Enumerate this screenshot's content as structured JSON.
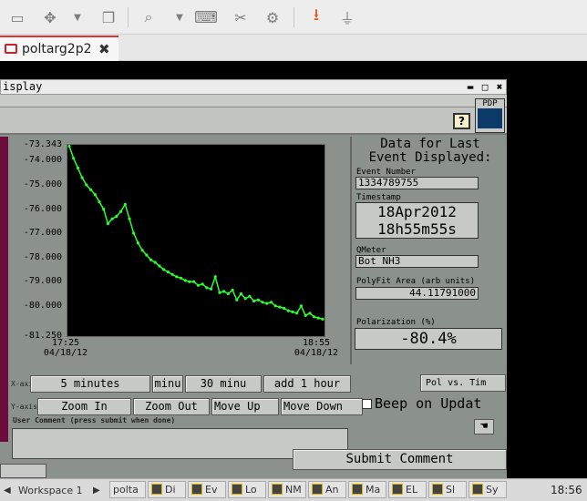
{
  "toolbar": {
    "icons": [
      "window-icon",
      "move-icon",
      "dropdown-icon",
      "copy-window-icon",
      "zoom-icon",
      "dropdown-icon",
      "keyboard-icon",
      "tools-icon",
      "settings-icon",
      "download-icon",
      "plug-icon"
    ]
  },
  "tab": {
    "title": "poltarg2p2",
    "close": "✖"
  },
  "window": {
    "title": "isplay",
    "min": "▬",
    "max": "□",
    "close": "✖"
  },
  "help": "?",
  "pdp": {
    "label": "PDP"
  },
  "chart_data": {
    "type": "line",
    "title": "",
    "ylim": [
      -81.25,
      -73.343
    ],
    "yticks": [
      "-73.343",
      "-74.000",
      "-75.000",
      "-76.000",
      "-77.000",
      "-78.000",
      "-79.000",
      "-80.000",
      "-81.250"
    ],
    "yticks_values": [
      -73.343,
      -74,
      -75,
      -76,
      -77,
      -78,
      -79,
      -80,
      -81.25
    ],
    "xticks": [
      {
        "time": "17:25",
        "date": "04/18/12"
      },
      {
        "time": "18:55",
        "date": "04/18/12"
      }
    ],
    "line_color": "#2bff2b",
    "series": [
      {
        "values": [
          -73.4,
          -73.9,
          -74.3,
          -74.7,
          -75.0,
          -75.2,
          -75.4,
          -75.7,
          -76.0,
          -76.6,
          -76.4,
          -76.3,
          -76.1,
          -75.8,
          -76.4,
          -77.0,
          -77.4,
          -77.7,
          -77.9,
          -78.1,
          -78.2,
          -78.35,
          -78.5,
          -78.6,
          -78.7,
          -78.8,
          -78.85,
          -78.95,
          -79.0,
          -79.0,
          -79.15,
          -79.1,
          -79.25,
          -79.3,
          -78.8,
          -79.45,
          -79.4,
          -79.5,
          -79.35,
          -79.75,
          -79.5,
          -79.7,
          -79.6,
          -79.8,
          -79.75,
          -79.85,
          -79.9,
          -79.85,
          -80.0,
          -80.05,
          -80.1,
          -80.2,
          -80.25,
          -80.3,
          -80.0,
          -80.4,
          -80.3,
          -80.45,
          -80.5,
          -80.55
        ]
      }
    ]
  },
  "info": {
    "heading1": "Data for Last",
    "heading2": "Event Displayed:",
    "event_number_label": "Event Number",
    "event_number": "1334789755",
    "timestamp_label": "Timestamp",
    "timestamp_date": "18Apr2012",
    "timestamp_time": "18h55m55s",
    "qmeter_label": "QMeter",
    "qmeter": "Bot NH3",
    "polyfit_label": "PolyFit Area (arb units)",
    "polyfit": "44.11791000",
    "polarization_label": "Polarization (%)",
    "polarization": "-80.4%"
  },
  "controls": {
    "x_axis_label": "X-axis",
    "y_axis_label": "Y-axis",
    "x_buttons": [
      "5 minutes",
      "minu",
      "30 minu",
      "add 1 hour"
    ],
    "y_buttons": [
      "Zoom In",
      "Zoom Out",
      "Move Up",
      "Move Down"
    ],
    "pol_vs_time": "Pol vs. Tim",
    "beep": "Beep on Updat",
    "user_comment_label": "User Comment (press submit when done)",
    "submit": "Submit Comment"
  },
  "taskbar": {
    "workspace": "Workspace 1",
    "items": [
      "polta",
      "Di",
      "Ev",
      "Lo",
      "NM",
      "An",
      "Ma",
      "EL",
      "Sl",
      "Sy"
    ],
    "clock": "18:56"
  }
}
